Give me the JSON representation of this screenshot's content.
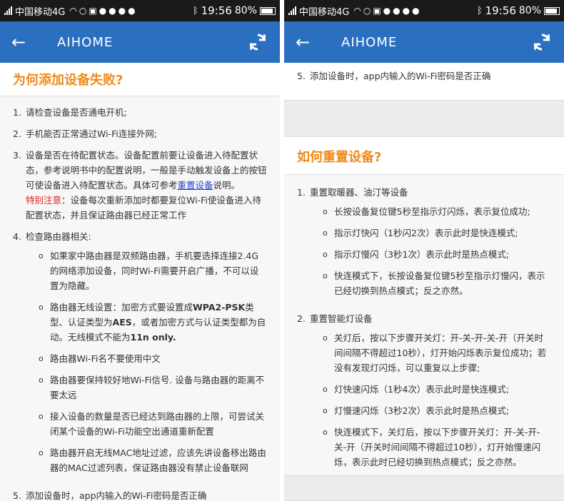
{
  "status": {
    "carrier": "中国移动4G",
    "time": "19:56",
    "battery": "80%"
  },
  "appbar": {
    "title": "AIHOME"
  },
  "left": {
    "title": "为何添加设备失败?",
    "items": [
      {
        "num": "1.",
        "text": "请检查设备是否通电开机;"
      },
      {
        "num": "2.",
        "text": "手机能否正常通过Wi-Fi连接外网;"
      },
      {
        "num": "3.",
        "text_a": "设备是否在待配置状态。设备配置前要让设备进入待配置状态，参考说明书中的配置说明，一般是手动触发设备上的按钮可使设备进入待配置状态。具体可参考",
        "link": "重置设备",
        "text_b": "说明。",
        "warn": "特别注意",
        "text_c": "：设备每次重新添加时都要复位Wi-Fi使设备进入待配置状态，并且保证路由器已经正常工作"
      },
      {
        "num": "4.",
        "text": "检查路由器相关:"
      },
      {
        "num": "5.",
        "text": "添加设备时，app内输入的Wi-Fi密码是否正确"
      }
    ],
    "sub": [
      {
        "text": "如果家中路由器是双频路由器，手机要选择连接2.4G的网络添加设备，同时Wi-Fi需要开启广播，不可以设置为隐藏。"
      },
      {
        "a": "路由器无线设置：加密方式要设置成",
        "b1": "WPA2-PSK",
        "c": "类型、认证类型为",
        "b2": "AES",
        "d": "，或者加密方式与认证类型都为自动。无线模式不能为",
        "b3": "11n only."
      },
      {
        "text": "路由器Wi-Fi名不要使用中文"
      },
      {
        "text": "路由器要保持较好地Wi-Fi信号. 设备与路由器的距离不要太远"
      },
      {
        "text": "接入设备的数量是否已经达到路由器的上限，可尝试关闭某个设备的Wi-Fi功能空出通道重新配置"
      },
      {
        "text": "路由器开启无线MAC地址过滤，应该先讲设备移出路由器的MAC过滤列表，保证路由器没有禁止设备联网"
      }
    ]
  },
  "right": {
    "top_item": {
      "num": "5.",
      "text": "添加设备时，app内输入的Wi-Fi密码是否正确"
    },
    "title": "如何重置设备?",
    "group1": {
      "num": "1.",
      "text": "重置取暖器、油汀等设备"
    },
    "group1_sub": [
      "长按设备复位键5秒至指示灯闪烁，表示复位成功;",
      "指示灯快闪（1秒闪2次）表示此时是快连模式;",
      "指示灯慢闪（3秒1次）表示此时是热点模式;",
      "快连模式下，长按设备复位键5秒至指示灯慢闪，表示已经切换到热点模式；反之亦然。"
    ],
    "group2": {
      "num": "2.",
      "text": "重置智能灯设备"
    },
    "group2_sub": [
      "关灯后，按以下步骤开关灯：开-关-开-关-开（开关时间间隔不得超过10秒），灯开始闪烁表示复位成功；若没有发现灯闪烁，可以重复以上步骤;",
      "灯快速闪烁（1秒4次）表示此时是快连模式;",
      "灯慢速闪烁（3秒2次）表示此时是热点模式;",
      "快连模式下，关灯后，按以下步骤开关灯：开-关-开-关-开（开关时间间隔不得超过10秒），灯开始慢速闪烁，表示此时已经切换到热点模式；反之亦然。"
    ]
  }
}
